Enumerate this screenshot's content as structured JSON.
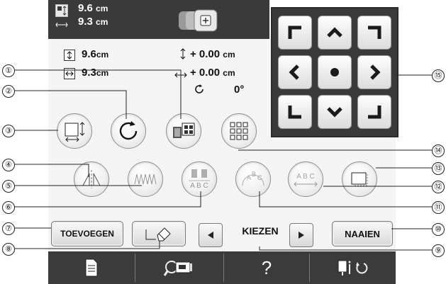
{
  "header": {
    "height_value": "9.6",
    "width_value": "9.3",
    "unit": "cm"
  },
  "info": {
    "height_value": "9.6",
    "width_value": "9.3",
    "unit": "cm",
    "vert_offset": "+ 0.00",
    "horiz_offset": "+ 0.00",
    "rotation": "0°"
  },
  "buttons": {
    "add_label": "TOEVOEGEN",
    "sew_label": "NAAIEN",
    "select_label": "KIEZEN"
  },
  "bottombar": {
    "help_label": "?"
  },
  "callouts": [
    "①",
    "②",
    "③",
    "④",
    "⑤",
    "⑥",
    "⑦",
    "⑧",
    "⑨",
    "⑩",
    "⑪",
    "⑫",
    "⑬",
    "⑭",
    "⑮"
  ]
}
